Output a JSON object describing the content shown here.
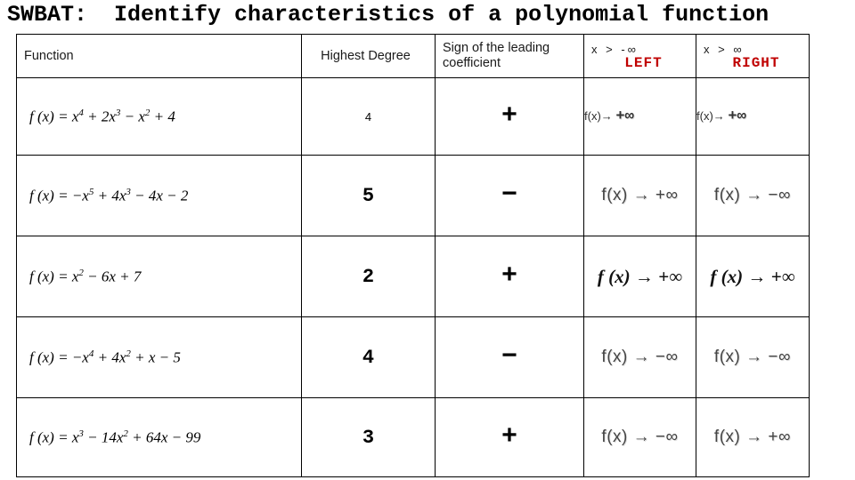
{
  "slide": {
    "title": "SWBAT:  Identify characteristics of a polynomial function"
  },
  "table": {
    "headers": {
      "function": "Function",
      "highest_degree": "Highest Degree",
      "leading_sign": "Sign of the leading coefficient",
      "left": {
        "limit": "x  >  -∞",
        "label": "LEFT"
      },
      "right": {
        "limit": "x  > ∞",
        "label": "RIGHT"
      }
    },
    "rows": [
      {
        "function_html": "f (x) = x<sup>4</sup> + 2x<sup>3</sup> &minus; x<sup>2</sup> + 4",
        "degree": "4",
        "sign": "+",
        "left": "f(x)→ +∞",
        "right": "f(x)→ +∞"
      },
      {
        "function_html": "f (x) = &minus;x<sup>5</sup> + 4x<sup>3</sup> &minus; 4x &minus; 2",
        "degree": "5",
        "sign": "−",
        "left": "f(x) → +∞",
        "right": "f(x) → −∞"
      },
      {
        "function_html": "f (x) = x<sup>2</sup> &minus; 6x + 7",
        "degree": "2",
        "sign": "+",
        "left": "f (x) → +∞",
        "right": "f (x) → +∞"
      },
      {
        "function_html": "f (x) = &minus;x<sup>4</sup> + 4x<sup>2</sup> + x &minus; 5",
        "degree": "4",
        "sign": "−",
        "left": "f(x) → −∞",
        "right": "f(x) → −∞"
      },
      {
        "function_html": "f (x) = x<sup>3</sup> &minus; 14x<sup>2</sup> + 64x &minus; 99",
        "degree": "3",
        "sign": "+",
        "left": "f(x) → −∞",
        "right": "f(x) → +∞"
      }
    ]
  },
  "colors": {
    "accent_red": "#c00000",
    "text": "#000000",
    "border": "#000000"
  }
}
